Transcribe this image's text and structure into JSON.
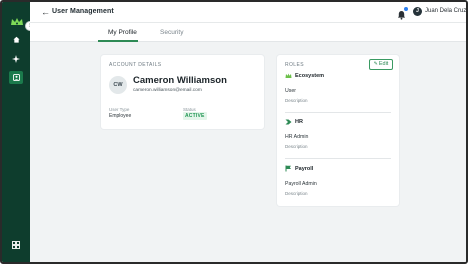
{
  "header": {
    "title": "User Management",
    "user_initial": "J",
    "user_name": "Juan Dela Cruz"
  },
  "tabs": [
    {
      "label": "My Profile",
      "active": true
    },
    {
      "label": "Security",
      "active": false
    }
  ],
  "account": {
    "section_title": "ACCOUNT DETAILS",
    "initials": "CW",
    "full_name": "Cameron Williamson",
    "email": "cameron.williamson@email.com",
    "user_type_label": "User Type",
    "user_type_value": "Employee",
    "status_label": "Status",
    "status_value": "ACTIVE"
  },
  "roles": {
    "section_title": "ROLES",
    "edit_label": "Edit",
    "items": [
      {
        "name": "Ecosystem",
        "role": "User",
        "description": "Description",
        "icon": "crown-icon"
      },
      {
        "name": "HR",
        "role": "HR Admin",
        "description": "Description",
        "icon": "hr-logo-icon"
      },
      {
        "name": "Payroll",
        "role": "Payroll Admin",
        "description": "Description",
        "icon": "payroll-flag-icon"
      }
    ]
  },
  "sidebar": {
    "items": [
      {
        "icon": "home-icon",
        "active": false
      },
      {
        "icon": "sparkle-icon",
        "active": false
      },
      {
        "icon": "user-management-icon",
        "active": true
      }
    ],
    "bottom_icon": "grid-icon"
  },
  "colors": {
    "sidebar_bg": "#0e3d2d",
    "accent_green": "#2e8a55",
    "status_green": "#219653",
    "notification_blue": "#2b7ff0"
  }
}
